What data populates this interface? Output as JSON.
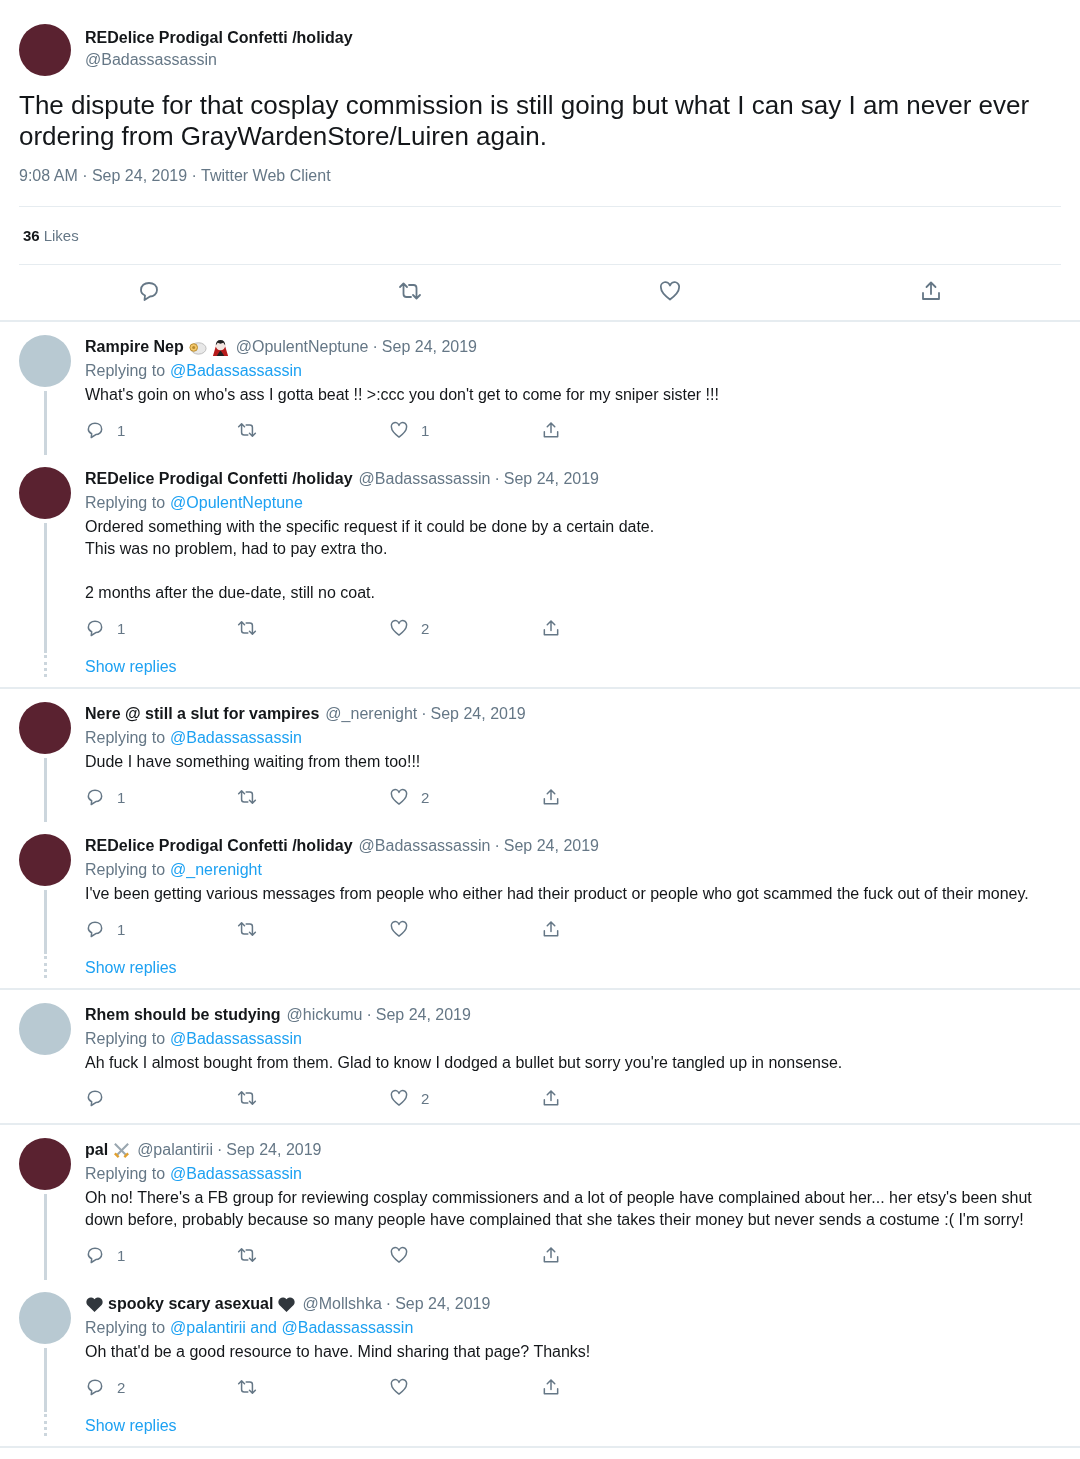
{
  "separator": "·",
  "tweet": {
    "name": "REDelice Prodigal Confetti /holiday",
    "handle": "@Badassassassin",
    "avatar": {
      "kind": "photo"
    },
    "text": "The dispute for that cosplay commission is still going but what I can say I am never ever ordering from GrayWardenStore/Luiren again.",
    "meta": "9:08 AM · Sep 24, 2019 · Twitter Web Client",
    "likes_count": "36",
    "likes_label": "Likes"
  },
  "conversations": [
    {
      "tweets": [
        {
          "name": "Rampire Nep",
          "name_icons": [
            {
              "kind": "ram"
            },
            {
              "kind": "vampire"
            }
          ],
          "handle": "@OpulentNeptune",
          "date": "Sep 24, 2019",
          "avatar": {
            "kind": "default"
          },
          "replying_label": "Replying to",
          "replying_to": "@Badassassassin",
          "text": "What's goin on who's ass I gotta beat !! >:ccc you don't get to come for my sniper sister !!!",
          "reply_count": "1",
          "like_count": "1"
        },
        {
          "name": "REDelice Prodigal Confetti /holiday",
          "handle": "@Badassassassin",
          "date": "Sep 24, 2019",
          "avatar": {
            "kind": "photo"
          },
          "replying_label": "Replying to",
          "replying_to": "@OpulentNeptune",
          "text": "Ordered something with the specific request if it could be done by a certain date.\nThis was no problem, had to pay extra tho.\n\n2 months after the due-date, still no coat.",
          "reply_count": "1",
          "like_count": "2"
        }
      ],
      "show_replies": "Show replies"
    },
    {
      "tweets": [
        {
          "name": "Nere @ still a slut for vampires",
          "handle": "@_nerenight",
          "date": "Sep 24, 2019",
          "avatar": {
            "kind": "photo"
          },
          "replying_label": "Replying to",
          "replying_to": "@Badassassassin",
          "text": "Dude I have something waiting from them too!!!",
          "reply_count": "1",
          "like_count": "2"
        },
        {
          "name": "REDelice Prodigal Confetti /holiday",
          "handle": "@Badassassassin",
          "date": "Sep 24, 2019",
          "avatar": {
            "kind": "photo"
          },
          "replying_label": "Replying to",
          "replying_to": "@_nerenight",
          "text": "I've been getting various messages from people who either had their product or people who got scammed the fuck out of their money.",
          "reply_count": "1"
        }
      ],
      "show_replies": "Show replies"
    },
    {
      "tweets": [
        {
          "name": "Rhem should be studying",
          "handle": "@hickumu",
          "date": "Sep 24, 2019",
          "avatar": {
            "kind": "default"
          },
          "replying_label": "Replying to",
          "replying_to": "@Badassassassin",
          "text": "Ah fuck I almost bought from them. Glad to know I dodged a bullet but sorry you're tangled up in nonsense.",
          "like_count": "2"
        }
      ]
    },
    {
      "tweets": [
        {
          "name": "pal",
          "name_icons": [
            {
              "kind": "swords"
            }
          ],
          "handle": "@palantirii",
          "date": "Sep 24, 2019",
          "avatar": {
            "kind": "photo"
          },
          "replying_label": "Replying to",
          "replying_to": "@Badassassassin",
          "text": "Oh no! There's a FB group for reviewing cosplay commissioners and a lot of people have complained about her... her etsy's been shut down before, probably because so many people have complained that she takes their money but never sends a costume :( I'm sorry!",
          "reply_count": "1"
        },
        {
          "name": "spooky scary asexual",
          "name_icons_before": [
            {
              "kind": "black-heart"
            }
          ],
          "name_icons": [
            {
              "kind": "black-heart"
            }
          ],
          "handle": "@Mollshka",
          "date": "Sep 24, 2019",
          "avatar": {
            "kind": "default"
          },
          "replying_label": "Replying to",
          "replying_to": "@palantirii and @Badassassassin",
          "text": "Oh that'd be a good resource to have. Mind sharing that page? Thanks!",
          "reply_count": "2"
        }
      ],
      "show_replies": "Show replies"
    }
  ]
}
